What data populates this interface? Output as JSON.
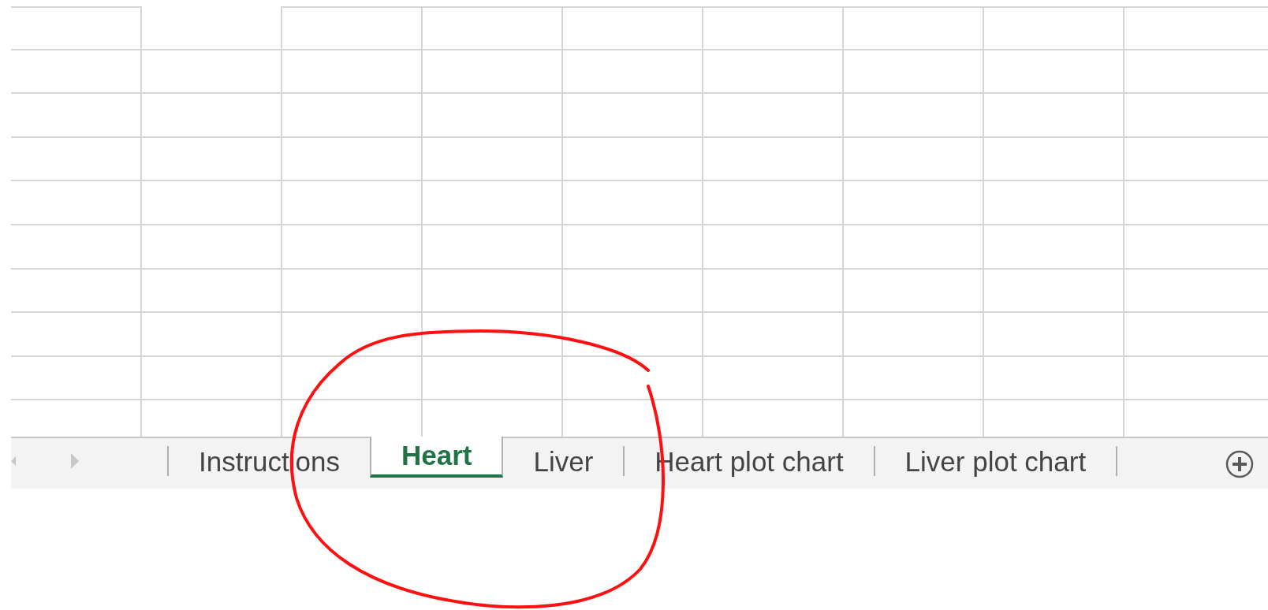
{
  "sheet_tabs": [
    {
      "label": "Instructions",
      "selected": false
    },
    {
      "label": "Heart",
      "selected": true
    },
    {
      "label": "Liver",
      "selected": false
    },
    {
      "label": "Heart plot chart",
      "selected": false
    },
    {
      "label": "Liver plot chart",
      "selected": false
    }
  ]
}
